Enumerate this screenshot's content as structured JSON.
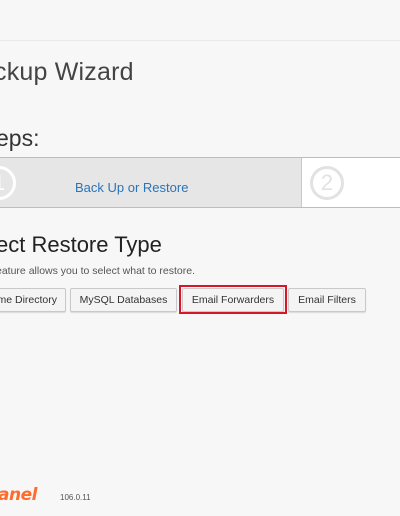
{
  "page": {
    "title": "ckup Wizard"
  },
  "steps": {
    "heading": "eps:",
    "items": [
      {
        "number": "1",
        "label": "Back Up or Restore",
        "active": true
      },
      {
        "number": "2",
        "label": "",
        "active": false
      }
    ]
  },
  "restore": {
    "title": "ect Restore Type",
    "description": "eature allows you to select what to restore.",
    "buttons": [
      {
        "label": "me Directory"
      },
      {
        "label": "MySQL Databases"
      },
      {
        "label": "Email Forwarders",
        "highlighted": true
      },
      {
        "label": "Email Filters"
      }
    ]
  },
  "footer": {
    "logo_text": "anel",
    "version": "106.0.11"
  },
  "colors": {
    "link": "#2a74b8",
    "highlight": "#d6172a",
    "brand": "#ff6c2c",
    "active_step_bg": "#e6e6e6"
  }
}
